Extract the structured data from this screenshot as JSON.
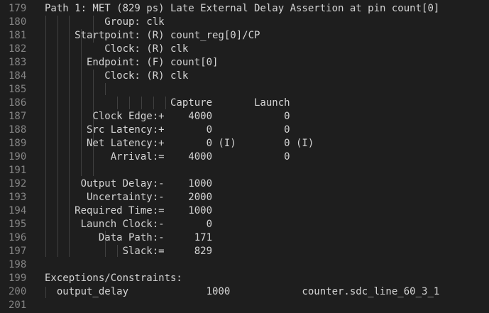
{
  "editor": {
    "lines": [
      {
        "num": "179",
        "text": "Path 1: MET (829 ps) Late External Delay Assertion at pin count[0]"
      },
      {
        "num": "180",
        "text": "          Group: clk"
      },
      {
        "num": "181",
        "text": "     Startpoint: (R) count_reg[0]/CP"
      },
      {
        "num": "182",
        "text": "          Clock: (R) clk"
      },
      {
        "num": "183",
        "text": "       Endpoint: (F) count[0]"
      },
      {
        "num": "184",
        "text": "          Clock: (R) clk"
      },
      {
        "num": "185",
        "text": ""
      },
      {
        "num": "186",
        "text": "                     Capture       Launch"
      },
      {
        "num": "187",
        "text": "        Clock Edge:+    4000            0"
      },
      {
        "num": "188",
        "text": "       Src Latency:+       0            0"
      },
      {
        "num": "189",
        "text": "       Net Latency:+       0 (I)        0 (I)"
      },
      {
        "num": "190",
        "text": "           Arrival:=    4000            0"
      },
      {
        "num": "191",
        "text": ""
      },
      {
        "num": "192",
        "text": "      Output Delay:-    1000"
      },
      {
        "num": "193",
        "text": "       Uncertainty:-    2000"
      },
      {
        "num": "194",
        "text": "     Required Time:=    1000"
      },
      {
        "num": "195",
        "text": "      Launch Clock:-       0"
      },
      {
        "num": "196",
        "text": "         Data Path:-     171"
      },
      {
        "num": "197",
        "text": "             Slack:=     829"
      },
      {
        "num": "198",
        "text": ""
      },
      {
        "num": "199",
        "text": "Exceptions/Constraints:"
      },
      {
        "num": "200",
        "text": "  output_delay             1000            counter.sdc_line_60_3_1"
      },
      {
        "num": "201",
        "text": ""
      }
    ]
  },
  "colors": {
    "background": "#1e1e1e",
    "text": "#d4d4d4",
    "line_number": "#858585",
    "indent_guide": "#404040"
  }
}
